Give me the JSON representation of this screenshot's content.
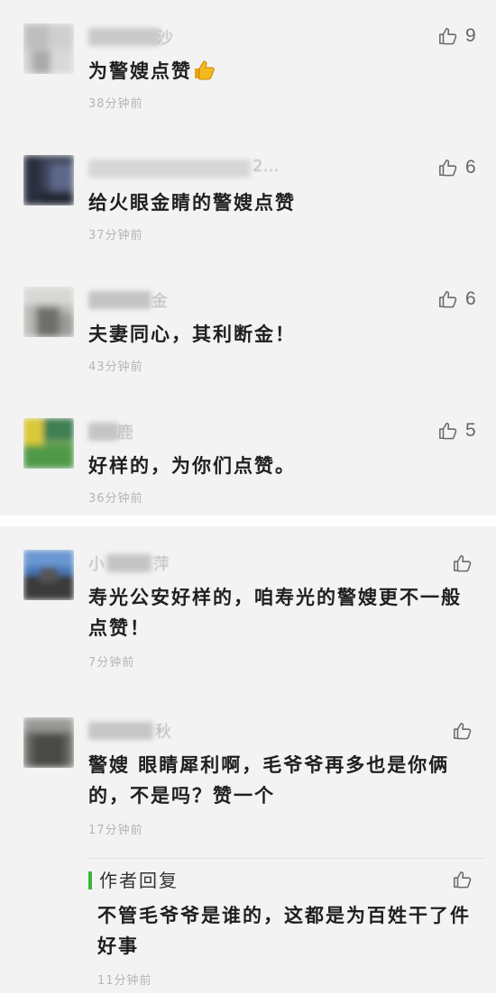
{
  "colors": {
    "panel_bg": "#f3f3f3",
    "text": "#1f1f1f",
    "time": "#b5b5b5",
    "reply_bar": "#3ab63a",
    "icon": "#6a6a6a"
  },
  "icons": {
    "like": "thumbs-up-icon",
    "emoji": "thumbs-up-emoji"
  },
  "panel1": {
    "comments": [
      {
        "nick_tail": "沙",
        "text": "为警嫂点赞",
        "time": "38分钟前",
        "likes": "9"
      },
      {
        "nick_tail": "2…",
        "text": "给火眼金睛的警嫂点赞",
        "time": "37分钟前",
        "likes": "6"
      },
      {
        "nick_tail": "金",
        "text": "夫妻同心，其利断金！",
        "time": "43分钟前",
        "likes": "6"
      },
      {
        "nick_tail": "鹿",
        "text": "好样的，为你们点赞。",
        "time": "36分钟前",
        "likes": "5"
      }
    ]
  },
  "panel2": {
    "comments": [
      {
        "nick_head": "小",
        "nick_tail": "萍",
        "text": "寿光公安好样的，咱寿光的警嫂更不一般点赞！",
        "time": "7分钟前"
      },
      {
        "nick_tail": "秋",
        "text": "警嫂  眼睛犀利啊，毛爷爷再多也是你俩的，不是吗？赞一个",
        "time": "17分钟前"
      }
    ],
    "reply": {
      "title": "作者回复",
      "text": "不管毛爷爷是谁的，这都是为百姓干了件好事",
      "time": "11分钟前"
    }
  }
}
